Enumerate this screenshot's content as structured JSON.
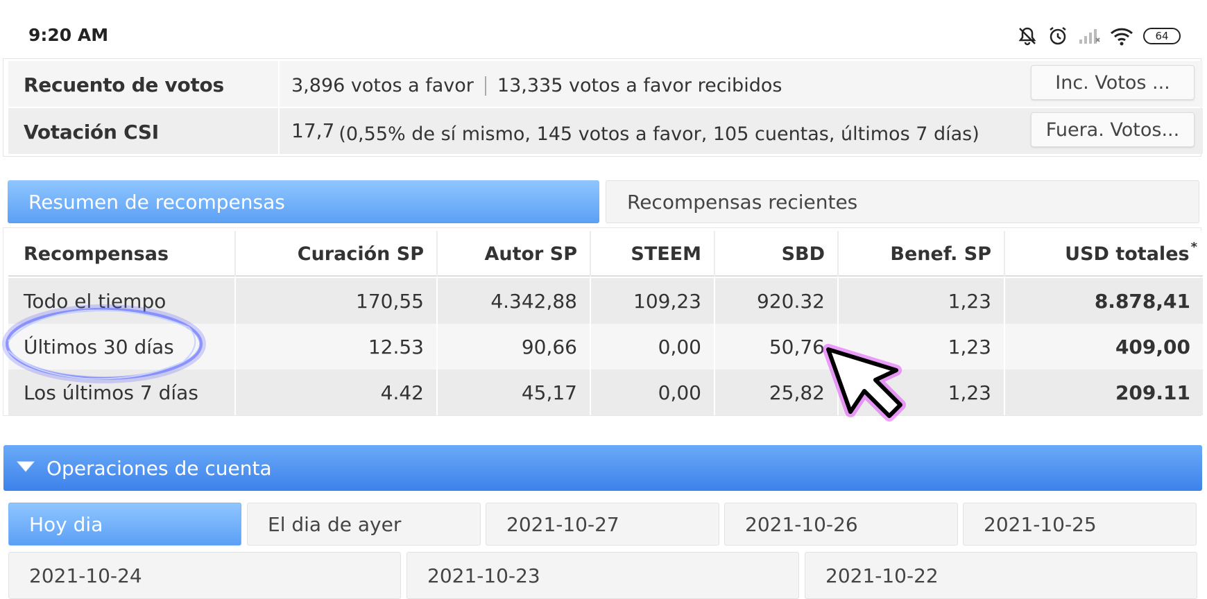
{
  "status_bar": {
    "time": "9:20 AM",
    "battery": "64",
    "icons": [
      "bell-off-icon",
      "alarm-icon",
      "signal-icon",
      "wifi-icon",
      "battery-icon"
    ]
  },
  "vote_info": {
    "rows": [
      {
        "label": "Recuento de votos",
        "value_a": "3,896 votos a favor",
        "value_b": "13,335 votos a favor recibidos",
        "button": "Inc. Votos ..."
      },
      {
        "label": "Votación CSI",
        "value_main": "17,7",
        "value_detail": "(0,55% de sí mismo, 145 votos a favor, 105 cuentas, últimos 7 días)",
        "button": "Fuera. Votos..."
      }
    ]
  },
  "reward_tabs": {
    "active": "Resumen de recompensas",
    "inactive": "Recompensas recientes"
  },
  "rewards_table": {
    "headers": [
      "Recompensas",
      "Curación SP",
      "Autor SP",
      "STEEM",
      "SBD",
      "Benef. SP",
      "USD totales"
    ],
    "asterisk": "*",
    "rows": [
      [
        "Todo el tiempo",
        "170,55",
        "4.342,88",
        "109,23",
        "920.32",
        "1,23",
        "8.878,41"
      ],
      [
        "Últimos 30 días",
        "12.53",
        "90,66",
        "0,00",
        "50,76",
        "1,23",
        "409,00"
      ],
      [
        "Los últimos 7 días",
        "4.42",
        "45,17",
        "0,00",
        "25,82",
        "1,23",
        "209.11"
      ]
    ]
  },
  "account_operations": {
    "title": "Operaciones de cuenta",
    "days_row1": [
      "Hoy dia",
      "El dia de ayer",
      "2021-10-27",
      "2021-10-26",
      "2021-10-25"
    ],
    "days_row2": [
      "2021-10-24",
      "2021-10-23",
      "2021-10-22"
    ]
  },
  "colors": {
    "tab_active": "#5b9ff5",
    "header_blue": "#3d82ea",
    "cursor_glow": "#e040fb"
  }
}
